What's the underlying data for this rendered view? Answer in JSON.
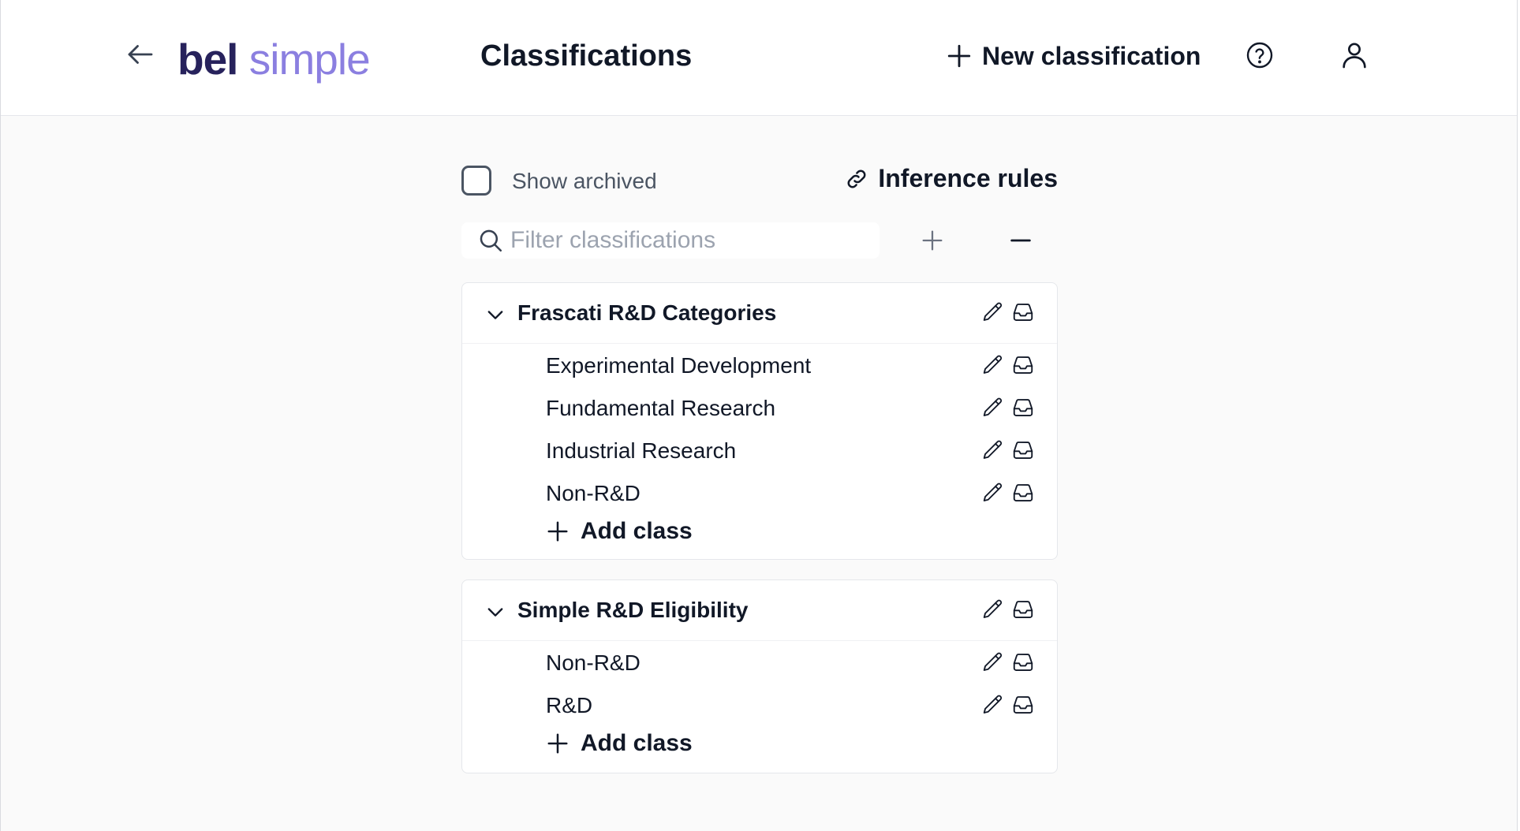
{
  "header": {
    "logo_primary": "bel",
    "logo_secondary": "simple",
    "title": "Classifications",
    "new_button_label": "New classification"
  },
  "toolbar": {
    "show_archived_label": "Show archived",
    "show_archived_checked": false,
    "inference_rules_label": "Inference rules",
    "filter_placeholder": "Filter classifications"
  },
  "classifications": [
    {
      "name": "Frascati R&D Categories",
      "expanded": true,
      "classes": [
        "Experimental Development",
        "Fundamental Research",
        "Industrial Research",
        "Non-R&D"
      ],
      "add_label": "Add class"
    },
    {
      "name": "Simple R&D Eligibility",
      "expanded": true,
      "classes": [
        "Non-R&D",
        "R&D"
      ],
      "add_label": "Add class"
    }
  ],
  "icons": {
    "back": "arrow-left-icon",
    "plus": "plus-icon",
    "help": "question-circle-icon",
    "user": "user-icon",
    "link": "link-icon",
    "search": "search-icon",
    "minus": "minus-icon",
    "chevron": "chevron-down-icon",
    "edit": "pencil-icon",
    "archive": "archive-inbox-icon"
  },
  "colors": {
    "logo_primary": "#27225c",
    "logo_secondary": "#8b7fe0",
    "page_background": "#fafafa"
  }
}
